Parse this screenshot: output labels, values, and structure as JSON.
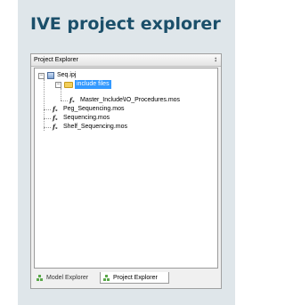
{
  "heading": "IVE project explorer",
  "panel": {
    "title": "Project Explorer",
    "pin_icon": "pin-icon"
  },
  "tree": {
    "project": {
      "label": "Seq.ipj",
      "icon": "project-icon",
      "expanded": true
    },
    "folder": {
      "label": "include files",
      "icon": "folder-icon",
      "expanded": true,
      "selected": true
    },
    "children_of_folder": [
      {
        "label": "Master_Include\\IO_Procedures.mos",
        "icon": "function-icon"
      }
    ],
    "children_of_project": [
      {
        "label": "Peg_Sequencing.mos",
        "icon": "function-icon"
      },
      {
        "label": "Sequencing.mos",
        "icon": "function-icon"
      },
      {
        "label": "Shelf_Sequencing.mos",
        "icon": "function-icon"
      }
    ]
  },
  "tabs": [
    {
      "label": "Model Explorer",
      "icon": "tree-icon",
      "active": false
    },
    {
      "label": "Project Explorer",
      "icon": "tree-icon",
      "active": true
    }
  ],
  "colors": {
    "heading": "#1b4f6a",
    "card_background": "#dfe6ea",
    "selection": "#3399ff"
  }
}
